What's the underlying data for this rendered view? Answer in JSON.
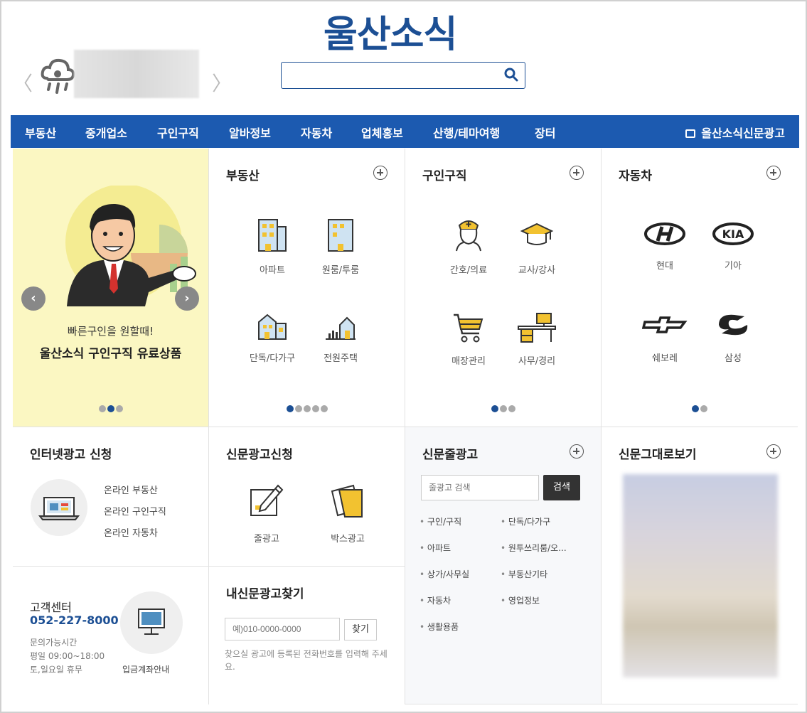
{
  "header": {
    "logo": "울산소식",
    "weather_icon": "rain-cloud-icon",
    "prev_symbol": "〈",
    "next_symbol": "〉",
    "search_placeholder": ""
  },
  "nav": {
    "items": [
      "부동산",
      "중개업소",
      "구인구직",
      "알바정보",
      "자동차",
      "업체홍보",
      "산행/테마여행",
      "장터"
    ],
    "newspaper_ad": "올산소식신문광고",
    "background": "#1c5ab0"
  },
  "banner": {
    "line1": "빠른구인을 원할때!",
    "line2": "울산소식 구인구직 유료상품",
    "prev": "‹",
    "next": "›",
    "background": "#fbf7c2"
  },
  "realestate": {
    "title": "부동산",
    "items": [
      "아파트",
      "원룸/투룸",
      "단독/다가구",
      "전원주택"
    ]
  },
  "jobs": {
    "title": "구인구직",
    "items": [
      "간호/의료",
      "교사/강사",
      "매장관리",
      "사무/경리"
    ]
  },
  "cars": {
    "title": "자동차",
    "items": [
      "현대",
      "기아",
      "쉐보레",
      "삼성"
    ],
    "kia_logo_text": "KIA"
  },
  "internet_ad": {
    "title": "인터넷광고 신청",
    "links": [
      "온라인 부동산",
      "온라인 구인구직",
      "온라인 자동차"
    ]
  },
  "newspaper_ad_apply": {
    "title": "신문광고신청",
    "items": [
      "줄광고",
      "박스광고"
    ]
  },
  "line_ad": {
    "title": "신문줄광고",
    "search_placeholder": "줄광고 검색",
    "search_button": "검색",
    "categories_left": [
      "구인/구직",
      "아파트",
      "상가/사무실",
      "자동차",
      "생활용품"
    ],
    "categories_right": [
      "단독/다가구",
      "원투쓰리룸/오...",
      "부동산기타",
      "영업정보"
    ]
  },
  "newspaper_view": {
    "title": "신문그대로보기"
  },
  "customer": {
    "title": "고객센터",
    "phone": "052-227-8000",
    "hours_label": "문의가능시간",
    "weekday": "평일 09:00~18:00",
    "weekend": "토,일요일 휴무",
    "deposit": "입금계좌안내"
  },
  "find_ad": {
    "title": "내신문광고찾기",
    "phone_placeholder": "예)010-0000-0000",
    "find_button": "찾기",
    "help": "찾으실 광고에 등록된 전화번호를 입력해 주세요."
  }
}
